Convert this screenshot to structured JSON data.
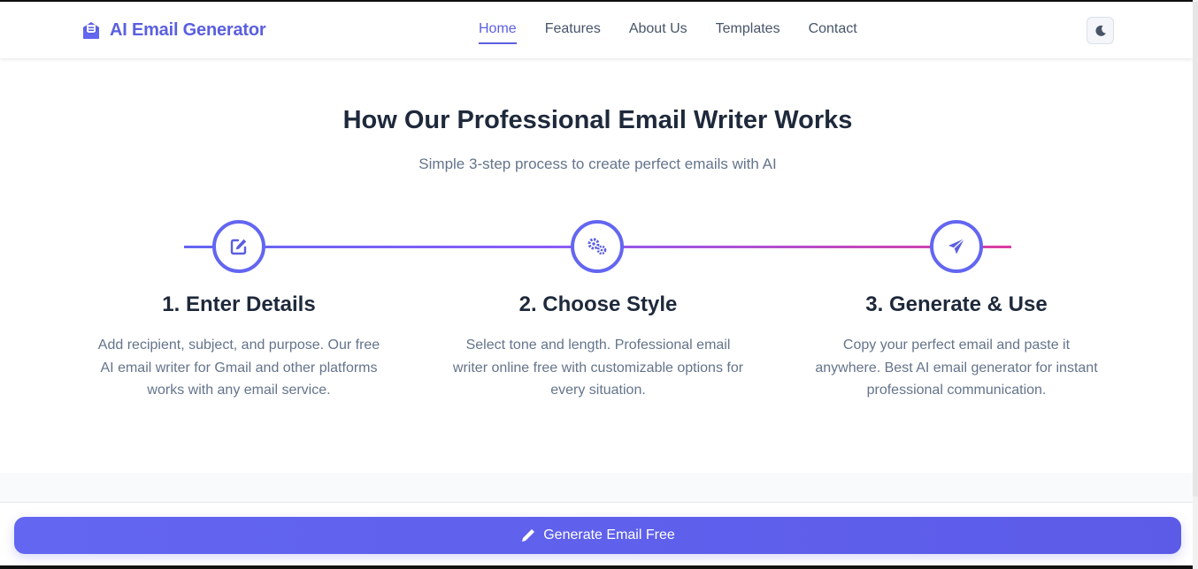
{
  "header": {
    "brand": "AI Email Generator",
    "nav": [
      {
        "label": "Home",
        "active": true
      },
      {
        "label": "Features",
        "active": false
      },
      {
        "label": "About Us",
        "active": false
      },
      {
        "label": "Templates",
        "active": false
      },
      {
        "label": "Contact",
        "active": false
      }
    ],
    "theme_toggle_icon": "moon-icon"
  },
  "section": {
    "title": "How Our Professional Email Writer Works",
    "subtitle": "Simple 3-step process to create perfect emails with AI"
  },
  "steps": [
    {
      "icon": "edit-icon",
      "title": "1. Enter Details",
      "lines": [
        "Add recipient, subject, and purpose. Our free",
        "AI email writer for Gmail and other platforms",
        "works with any email service."
      ]
    },
    {
      "icon": "gears-icon",
      "title": "2. Choose Style",
      "lines": [
        "Select tone and length. Professional email",
        "writer online free with customizable options for",
        "every situation."
      ]
    },
    {
      "icon": "send-icon",
      "title": "3. Generate & Use",
      "lines": [
        "Copy your perfect email and paste it",
        "anywhere. Best AI email generator for instant",
        "professional communication."
      ]
    }
  ],
  "cta": {
    "label": "Generate Email Free",
    "icon": "pencil-icon"
  },
  "colors": {
    "accent": "#6366f1",
    "gradient_end": "#db3ea0",
    "text_dark": "#1e293b",
    "text_muted": "#64748b"
  }
}
